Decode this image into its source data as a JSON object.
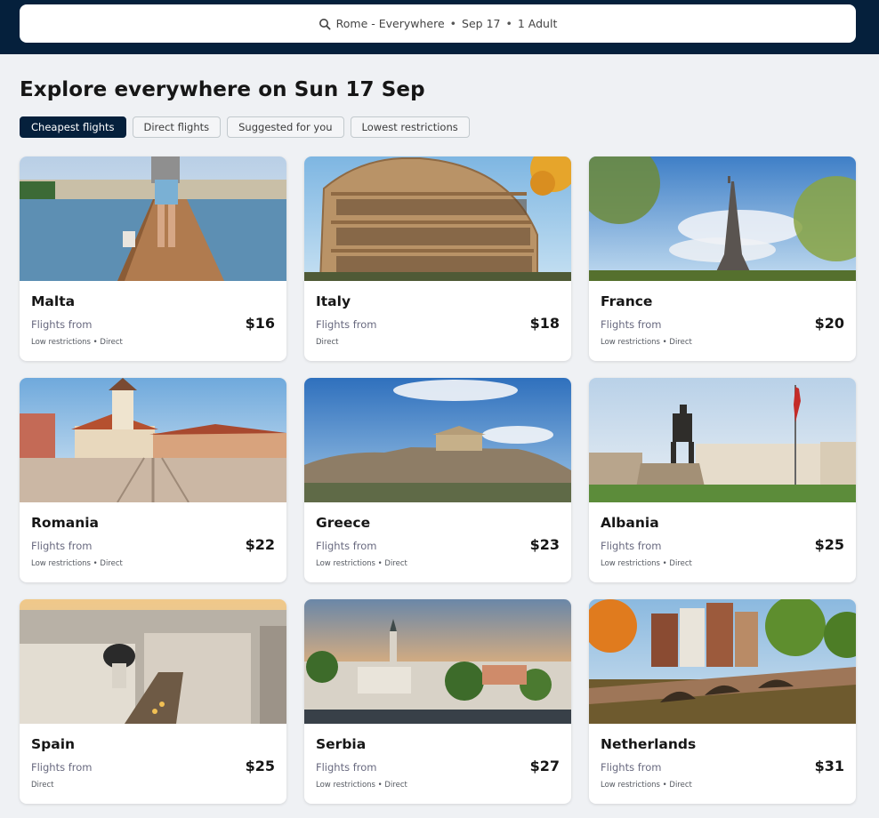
{
  "search": {
    "origin_dest": "Rome - Everywhere",
    "date": "Sep 17",
    "travellers": "1 Adult",
    "separator": "•"
  },
  "page": {
    "title": "Explore everywhere on Sun 17 Sep"
  },
  "filters": [
    {
      "label": "Cheapest flights",
      "active": true
    },
    {
      "label": "Direct flights",
      "active": false
    },
    {
      "label": "Suggested for you",
      "active": false
    },
    {
      "label": "Lowest restrictions",
      "active": false
    }
  ],
  "flights_from_label": "Flights from",
  "colors": {
    "brand_dark": "#05203c",
    "page_bg": "#eff1f4",
    "card_bg": "#ffffff"
  },
  "destinations": [
    {
      "country": "Malta",
      "price": "$16",
      "tags": "Low restrictions • Direct",
      "image": "pier-with-dog"
    },
    {
      "country": "Italy",
      "price": "$18",
      "tags": "Direct",
      "image": "colosseum"
    },
    {
      "country": "France",
      "price": "$20",
      "tags": "Low restrictions • Direct",
      "image": "eiffel-tower"
    },
    {
      "country": "Romania",
      "price": "$22",
      "tags": "Low restrictions • Direct",
      "image": "town-square-clock-tower"
    },
    {
      "country": "Greece",
      "price": "$23",
      "tags": "Low restrictions • Direct",
      "image": "acropolis"
    },
    {
      "country": "Albania",
      "price": "$25",
      "tags": "Low restrictions • Direct",
      "image": "equestrian-statue-flag"
    },
    {
      "country": "Spain",
      "price": "$25",
      "tags": "Direct",
      "image": "city-dome-avenue"
    },
    {
      "country": "Serbia",
      "price": "$27",
      "tags": "Low restrictions • Direct",
      "image": "cityscape-church-spire"
    },
    {
      "country": "Netherlands",
      "price": "$31",
      "tags": "Low restrictions • Direct",
      "image": "canal-bridge"
    }
  ]
}
